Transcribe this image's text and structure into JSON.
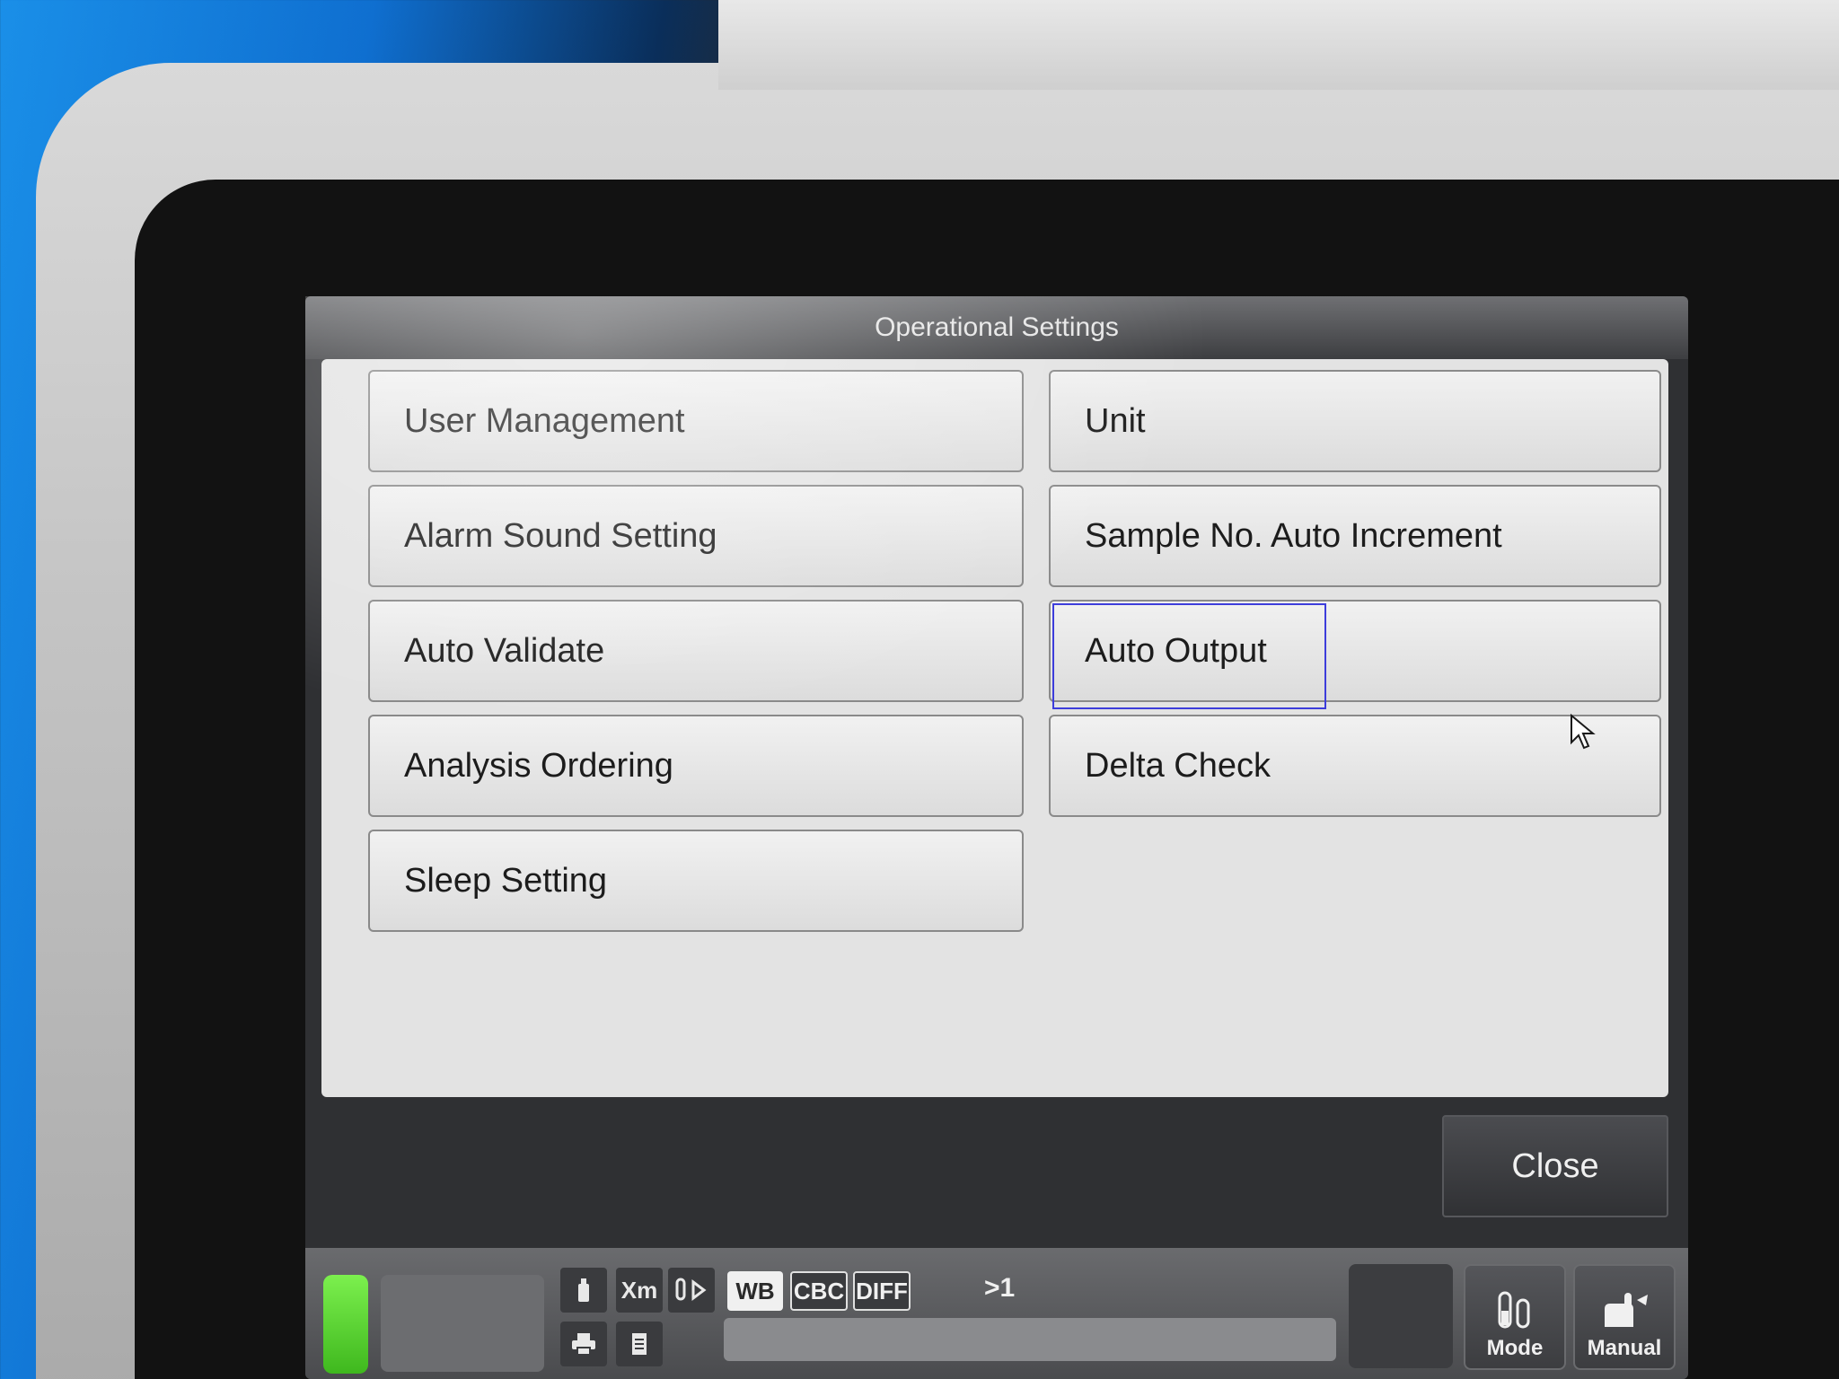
{
  "window": {
    "title": "Operational Settings"
  },
  "menu": {
    "left": [
      {
        "label": "User Management"
      },
      {
        "label": "Alarm Sound Setting"
      },
      {
        "label": "Auto Validate"
      },
      {
        "label": "Analysis Ordering"
      },
      {
        "label": "Sleep Setting"
      }
    ],
    "right": [
      {
        "label": "Unit"
      },
      {
        "label": "Sample No. Auto Increment"
      },
      {
        "label": "Auto Output",
        "selected": true
      },
      {
        "label": "Delta Check"
      }
    ]
  },
  "actions": {
    "close_label": "Close"
  },
  "status_bar": {
    "icons": [
      "reagent-bottle-icon",
      "xm-icon",
      "tube-play-icon",
      "printer-icon",
      "document-icon"
    ],
    "xm_label": "Xm",
    "chips": {
      "wb": "WB",
      "cbc": "CBC",
      "diff": "DIFF"
    },
    "counter": ">1",
    "mode_label": "Mode",
    "manual_label": "Manual"
  },
  "colors": {
    "ready_lamp": "#5fd935",
    "focus_border": "#3d3ddb",
    "panel_bg": "#e3e3e3",
    "frame_bg": "#2f3033"
  }
}
